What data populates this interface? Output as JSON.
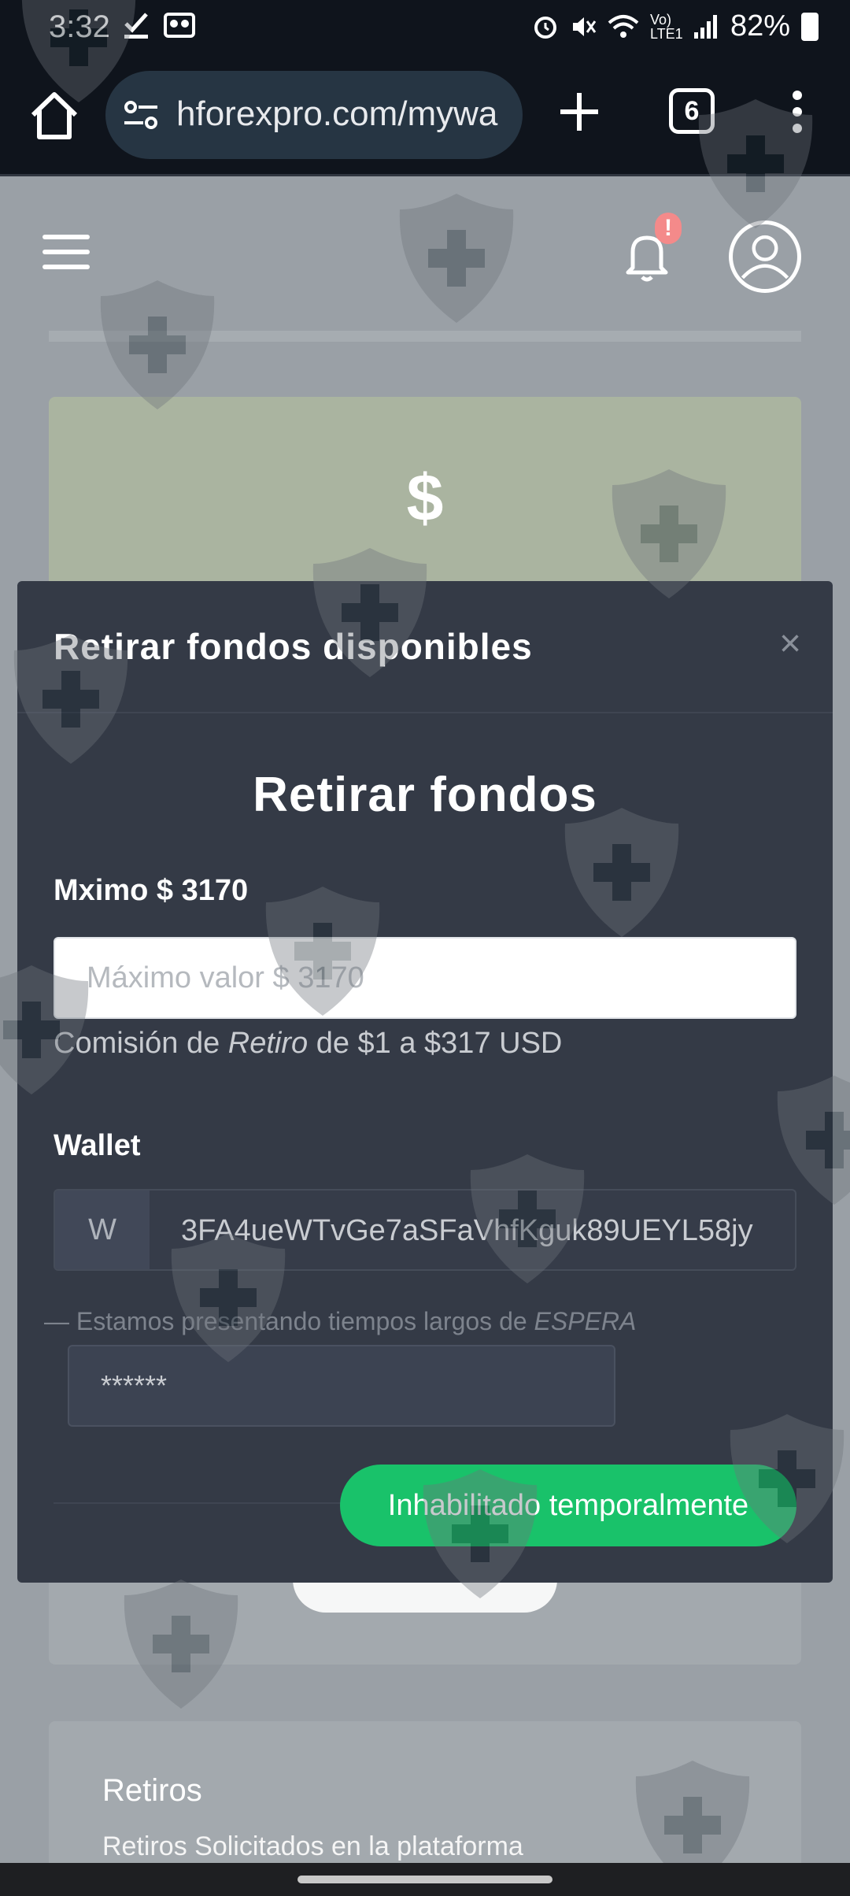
{
  "status_bar": {
    "time": "3:32",
    "battery": "82%",
    "network": "Vo) LTE1",
    "icons": [
      "check-download-icon",
      "voicemail-icon",
      "alarm-icon",
      "mute-icon",
      "wifi-icon",
      "signal-icon",
      "battery-icon"
    ]
  },
  "browser": {
    "url": "hforexpro.com/mywa",
    "tab_count": "6",
    "icons": [
      "home-icon",
      "site-settings-icon",
      "new-tab-icon",
      "tabs-icon",
      "more-menu-icon"
    ]
  },
  "page": {
    "balance_symbol": "$",
    "notification_badge": "!",
    "retiros_title": "Retiros",
    "retiros_subtitle": "Retiros Solicitados en la plataforma"
  },
  "modal": {
    "title": "Retirar fondos disponibles",
    "close_symbol": "×",
    "heading": "Retirar fondos",
    "max_label": "Mximo $ 3170",
    "amount_placeholder": "Máximo valor $ 3170",
    "fee_before": "Comisión de ",
    "fee_emphasis": "Retiro",
    "fee_after": " de $1 a $317 USD",
    "wallet_label": "Wallet",
    "wallet_prefix": "W",
    "wallet_value": "3FA4ueWTvGe7aSFaVhfKguk89UEYL58jy",
    "wait_before": "— Estamos presentando tiempos largos de ",
    "wait_emphasis": "ESPERA",
    "password_value": "******",
    "submit_label": "Inhabilitado temporalmente"
  },
  "colors": {
    "modal_bg": "#343a46",
    "accent_green": "#19c26a",
    "browser_bg": "#0f141c",
    "page_bg": "#9aa0a6",
    "badge": "#f48a8a"
  }
}
